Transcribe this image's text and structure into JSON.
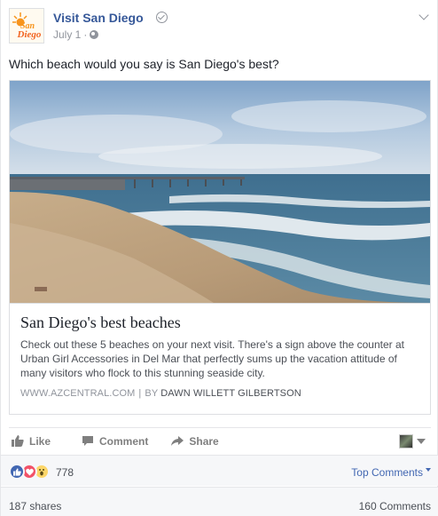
{
  "post": {
    "page_name": "Visit San Diego",
    "date": "July 1",
    "dot": "·",
    "text": "Which beach would you say is San Diego's best?",
    "logo_text": "San Diego"
  },
  "link_card": {
    "title": "San Diego's best beaches",
    "description": "Check out these 5 beaches on your next visit. There's a sign above the counter at Urban Girl Accessories in Del Mar that perfectly sums up the vacation attitude of many visitors who flock to this stunning seaside city.",
    "source": "WWW.AZCENTRAL.COM",
    "separator": "|",
    "by": "BY",
    "author": "DAWN WILLETT GILBERTSON"
  },
  "actions": {
    "like": "Like",
    "comment": "Comment",
    "share": "Share"
  },
  "reactions": {
    "count": "778",
    "sort_label": "Top Comments"
  },
  "stats": {
    "shares": "187 shares",
    "comments": "160 Comments"
  },
  "colors": {
    "link_blue": "#365899",
    "like_blue": "#4267b2",
    "love_red": "#f25268",
    "wow_yellow": "#fcd669",
    "logo_orange": "#f7941d"
  }
}
